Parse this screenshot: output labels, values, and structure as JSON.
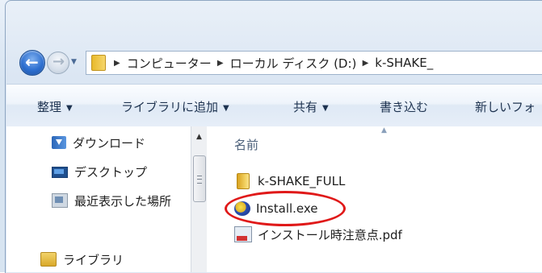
{
  "address_bar": {
    "crumbs": [
      "コンピューター",
      "ローカル ディスク (D:)",
      "k-SHAKE_"
    ]
  },
  "command_bar": {
    "organize": "整理",
    "add_to_library": "ライブラリに追加",
    "share": "共有",
    "burn": "書き込む",
    "new_folder": "新しいフォ"
  },
  "nav_pane": {
    "items": [
      {
        "label": "ダウンロード",
        "icon": "download-folder-icon"
      },
      {
        "label": "デスクトップ",
        "icon": "desktop-icon"
      },
      {
        "label": "最近表示した場所",
        "icon": "recent-places-icon"
      },
      {
        "label": "ライブラリ",
        "icon": "libraries-icon"
      }
    ]
  },
  "file_list": {
    "column_name": "名前",
    "files": [
      {
        "name": "k-SHAKE_FULL",
        "icon": "folder-icon"
      },
      {
        "name": "Install.exe",
        "icon": "installer-icon"
      },
      {
        "name": "インストール時注意点.pdf",
        "icon": "pdf-icon"
      }
    ]
  },
  "colors": {
    "highlight": "#e01919",
    "accent": "#2d6fd0"
  }
}
